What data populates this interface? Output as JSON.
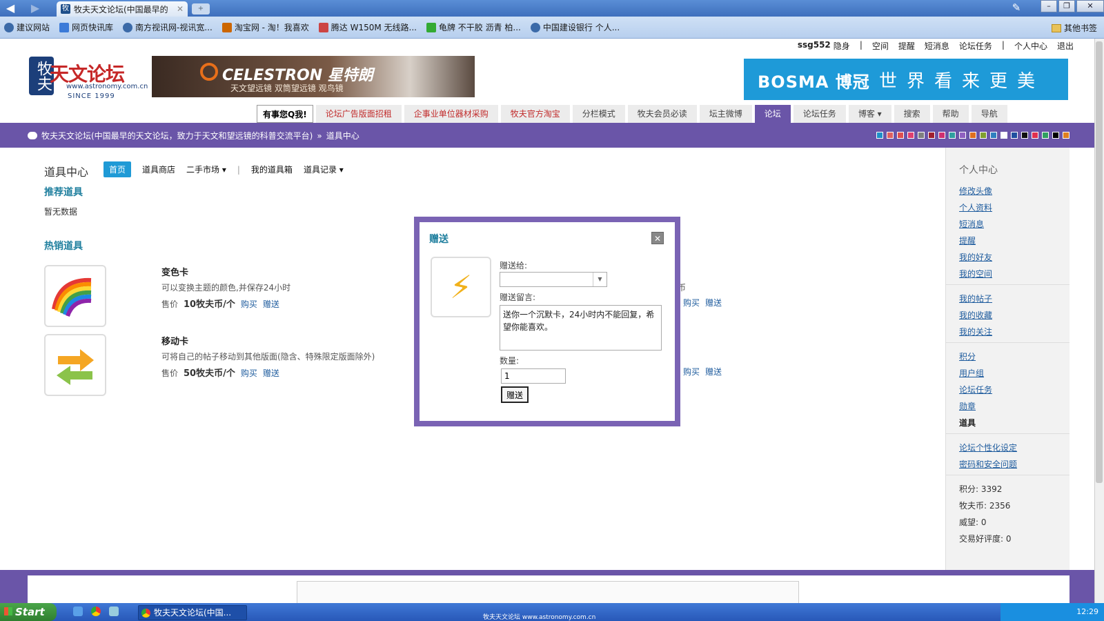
{
  "browser": {
    "tab_title": "牧夫天文论坛(中国最早的",
    "bookmarks": [
      {
        "label": "建议网站",
        "icon": "web-icon"
      },
      {
        "label": "网页快讯库",
        "icon": "feed-icon"
      },
      {
        "label": "南方视讯网-视讯宽...",
        "icon": "web-icon"
      },
      {
        "label": "淘宝网 - 淘！我喜欢",
        "icon": "taobao-icon"
      },
      {
        "label": "腾达 W150M 无线路...",
        "icon": "router-icon"
      },
      {
        "label": "龟牌 不干胶 沥青 柏...",
        "icon": "page-icon"
      },
      {
        "label": "中国建设银行 个人...",
        "icon": "web-icon"
      }
    ],
    "other_bookmarks": "其他书签"
  },
  "userbar": [
    "ssg552",
    "隐身",
    "|",
    "空间",
    "提醒",
    "短消息",
    "论坛任务",
    "|",
    "个人中心",
    "退出"
  ],
  "header": {
    "logo_char": "牧夫",
    "logo_title": "天文论坛",
    "logo_url": "www.astronomy.com.cn",
    "logo_since": "SINCE 1999",
    "ad_brand": "CELESTRON 星特朗",
    "ad_sub": "天文望远镜 双筒望远镜 观鸟镜",
    "bosma_brand": "BOSMA 博冠",
    "bosma_slogan": "世界看来更美"
  },
  "nav": {
    "qq": "有事您Q我!",
    "tabs": [
      {
        "label": "论坛广告版面招租",
        "style": "red"
      },
      {
        "label": "企事业单位器材采购",
        "style": "red"
      },
      {
        "label": "牧夫官方淘宝",
        "style": "red"
      },
      {
        "label": "分栏模式",
        "style": ""
      },
      {
        "label": "牧夫会员必读",
        "style": ""
      },
      {
        "label": "坛主微博",
        "style": ""
      },
      {
        "label": "论坛",
        "style": "active"
      },
      {
        "label": "论坛任务",
        "style": ""
      },
      {
        "label": "博客 ▾",
        "style": ""
      },
      {
        "label": "搜索",
        "style": ""
      },
      {
        "label": "帮助",
        "style": ""
      },
      {
        "label": "导航",
        "style": ""
      }
    ]
  },
  "breadcrumb": {
    "forum": "牧夫天文论坛(中国最早的天文论坛，致力于天文和望远镜的科普交流平台)",
    "sep": "»",
    "current": "道具中心"
  },
  "swatch_colors": [
    "#1e90c8",
    "#e06060",
    "#e05050",
    "#e04070",
    "#808080",
    "#a02030",
    "#d03070",
    "#30a0a0",
    "#9060c0",
    "#e07020",
    "#80a030",
    "#3080c0",
    "#ffffff",
    "#2050a0",
    "#101010",
    "#e03050",
    "#30a060",
    "#000000",
    "#e08020"
  ],
  "page": {
    "title": "道具中心",
    "subnav": [
      "首页",
      "道具商店",
      "二手市场 ▾",
      "|",
      "我的道具箱",
      "道具记录 ▾"
    ],
    "recommended_title": "推荐道具",
    "recommended_empty": "暂无数据",
    "hot_title": "热销道具",
    "items": [
      {
        "name": "变色卡",
        "desc": "可以变换主题的颜色,并保存24小时",
        "price_label": "售价",
        "price": "10牧夫币/个",
        "buy": "购买",
        "gift": "赠送",
        "icon": "rainbow-icon"
      },
      {
        "name": "移动卡",
        "desc": "可将自己的帖子移动到其他版面(隐含、特殊限定版面除外)",
        "price_label": "售价",
        "price": "50牧夫币/个",
        "buy": "购买",
        "gift": "赠送",
        "icon": "arrows-icon"
      }
    ],
    "right_col_cut": "币",
    "right_buy": "购买",
    "right_gift": "赠送"
  },
  "sidebar": {
    "title": "个人中心",
    "group1": [
      "修改头像",
      "个人资料",
      "短消息",
      "提醒",
      "我的好友",
      "我的空间"
    ],
    "group2": [
      "我的帖子",
      "我的收藏",
      "我的关注"
    ],
    "group3": [
      "积分",
      "用户组",
      "论坛任务",
      "勋章",
      "道具"
    ],
    "group4": [
      "论坛个性化设定",
      "密码和安全问题"
    ],
    "stats": [
      "积分: 3392",
      "牧夫币: 2356",
      "威望: 0",
      "交易好评度: 0"
    ]
  },
  "dialog": {
    "title": "赠送",
    "to_label": "赠送给:",
    "msg_label": "赠送留言:",
    "msg_value": "送你一个沉默卡，24小时内不能回复，希望你能喜欢。",
    "qty_label": "数量:",
    "qty_value": "1",
    "submit": "赠送"
  },
  "taskbar": {
    "start": "Start",
    "app": "牧夫天文论坛(中国...",
    "status_url": "牧夫天文论坛 www.astronomy.com.cn",
    "clock": "12:29"
  }
}
